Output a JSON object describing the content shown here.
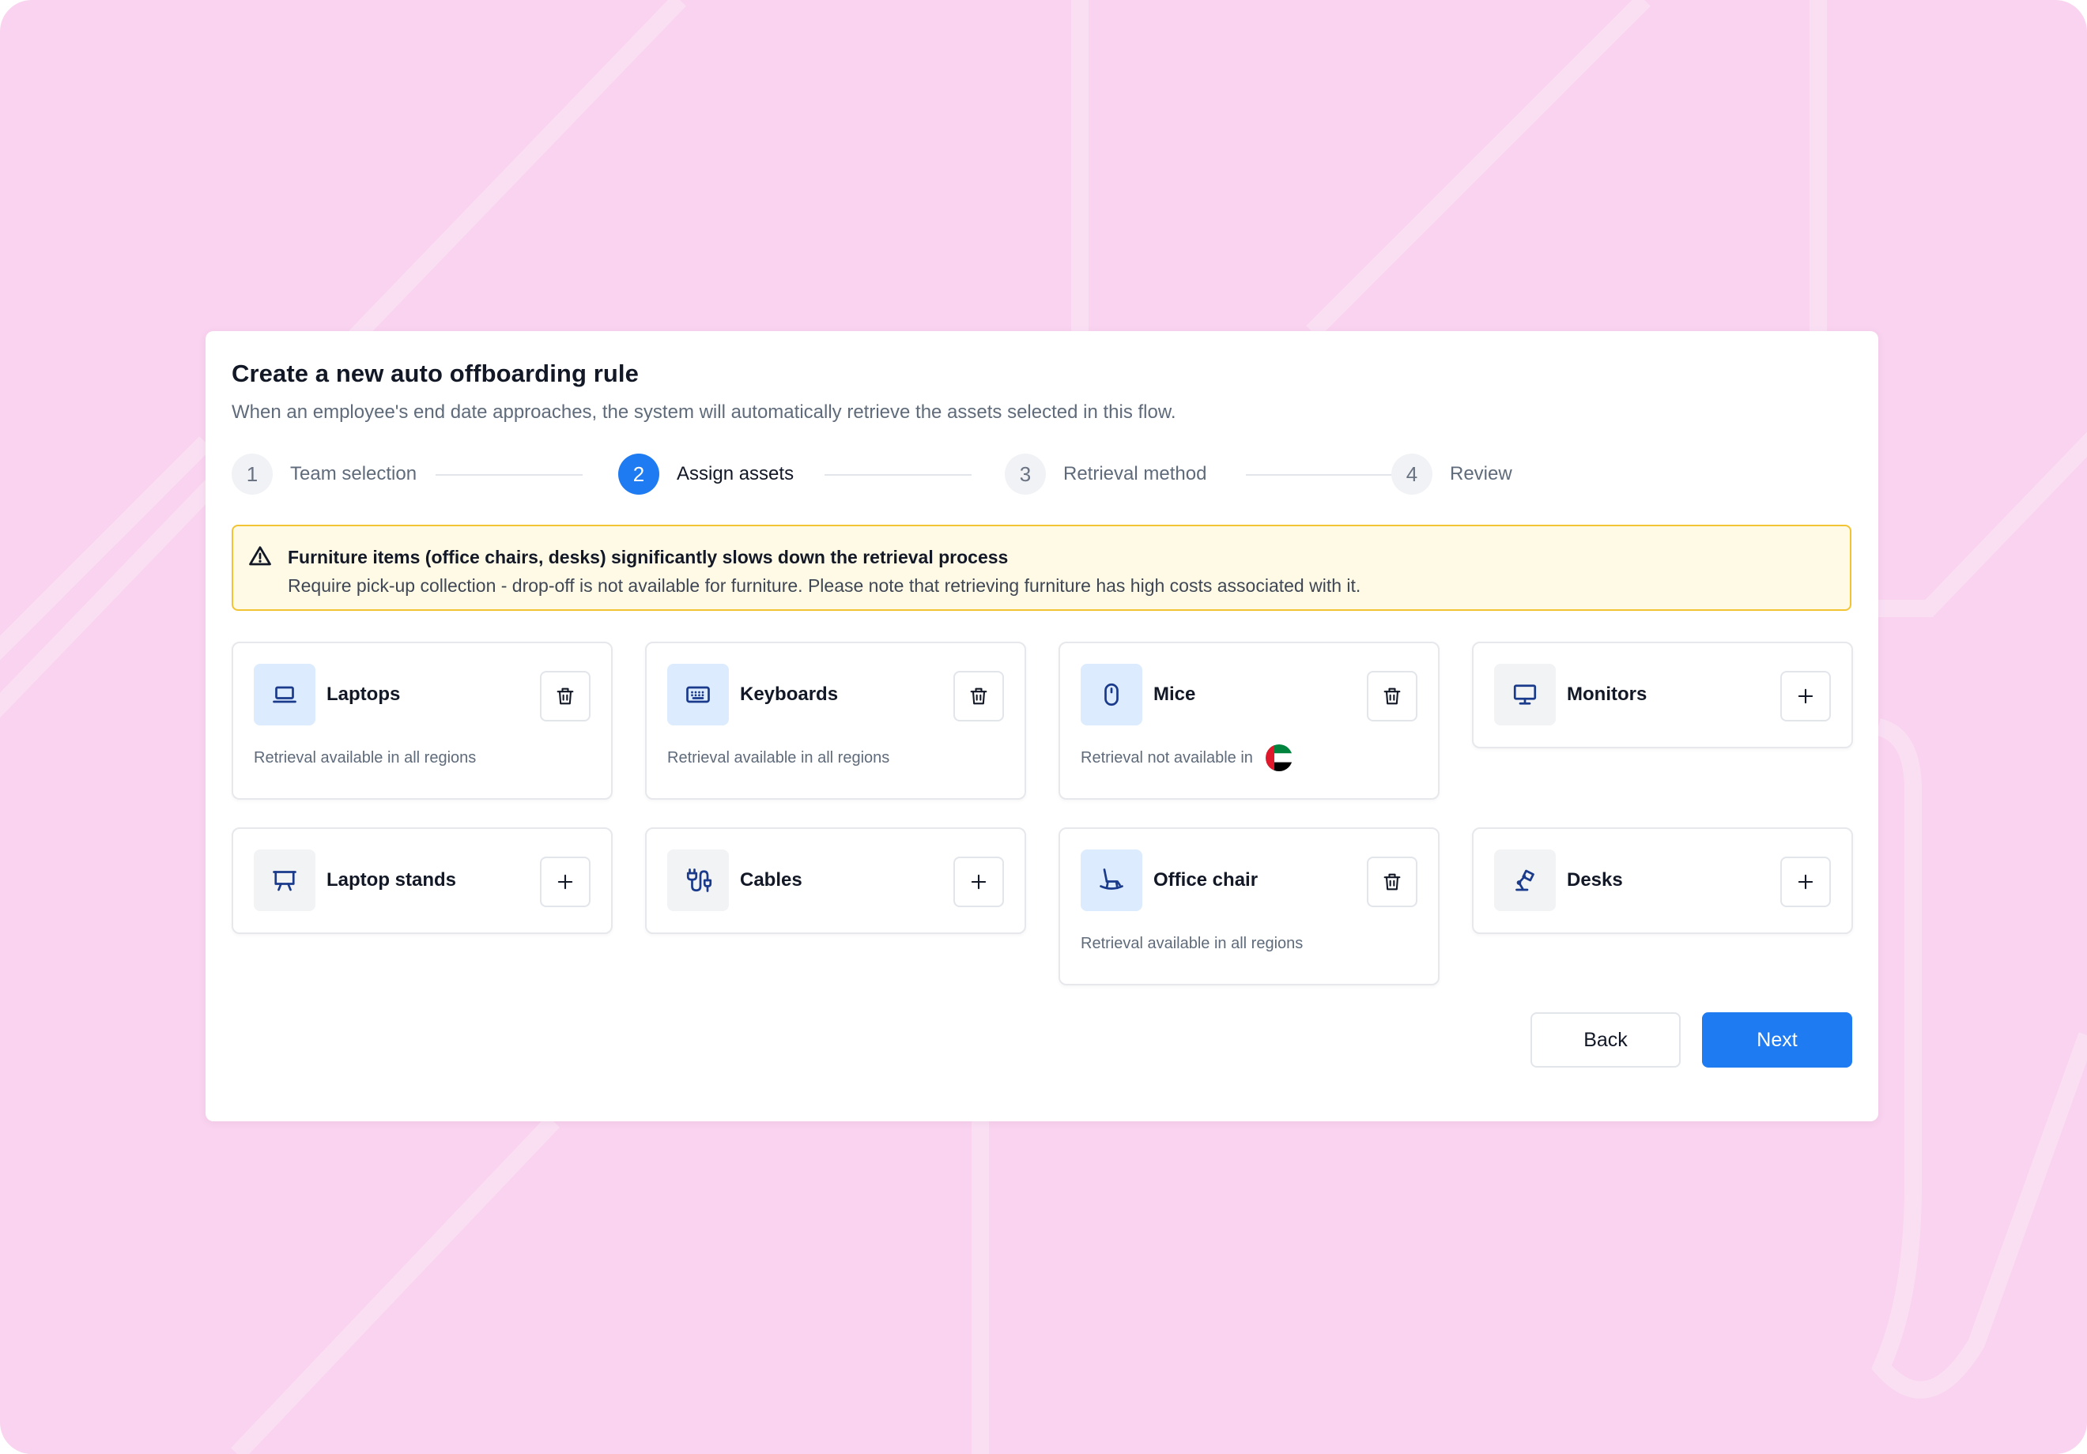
{
  "modal": {
    "title": "Create a new auto offboarding rule",
    "subtitle": "When an employee's end date approaches, the system will automatically retrieve the assets selected in this flow."
  },
  "stepper": {
    "current_step": 2,
    "steps": [
      {
        "number": "1",
        "label": "Team selection"
      },
      {
        "number": "2",
        "label": "Assign assets"
      },
      {
        "number": "3",
        "label": "Retrieval method"
      },
      {
        "number": "4",
        "label": "Review"
      }
    ]
  },
  "warning": {
    "icon": "warning-triangle-icon",
    "title": "Furniture items (office chairs, desks) significantly slows down the retrieval process",
    "text": "Require pick-up collection - drop-off is not available for furniture. Please note that retrieving furniture has high costs associated with it."
  },
  "assets": [
    {
      "name": "Laptops",
      "icon": "laptop-icon",
      "selected": true,
      "action": "delete-icon",
      "status": "Retrieval available in all regions"
    },
    {
      "name": "Keyboards",
      "icon": "keyboard-icon",
      "selected": true,
      "action": "delete-icon",
      "status": "Retrieval available in all regions"
    },
    {
      "name": "Mice",
      "icon": "mouse-icon",
      "selected": true,
      "action": "delete-icon",
      "status": "Retrieval not available in",
      "status_flag": "uae-flag-icon"
    },
    {
      "name": "Monitors",
      "icon": "monitor-icon",
      "selected": false,
      "action": "plus-icon"
    },
    {
      "name": "Laptop stands",
      "icon": "laptop-stand-icon",
      "selected": false,
      "action": "plus-icon"
    },
    {
      "name": "Cables",
      "icon": "cable-icon",
      "selected": false,
      "action": "plus-icon"
    },
    {
      "name": "Office chair",
      "icon": "office-chair-icon",
      "selected": true,
      "action": "delete-icon",
      "status": "Retrieval available in all regions"
    },
    {
      "name": "Desks",
      "icon": "desk-lamp-icon",
      "selected": false,
      "action": "plus-icon"
    }
  ],
  "footer": {
    "back_label": "Back",
    "next_label": "Next"
  },
  "colors": {
    "background": "#f9d3ef",
    "primary": "#1f7bf1",
    "warning_border": "#f2c433",
    "warning_bg": "#fffae6",
    "selected_icon_bg": "#dcebfd",
    "icon_color": "#1a3a8c"
  }
}
